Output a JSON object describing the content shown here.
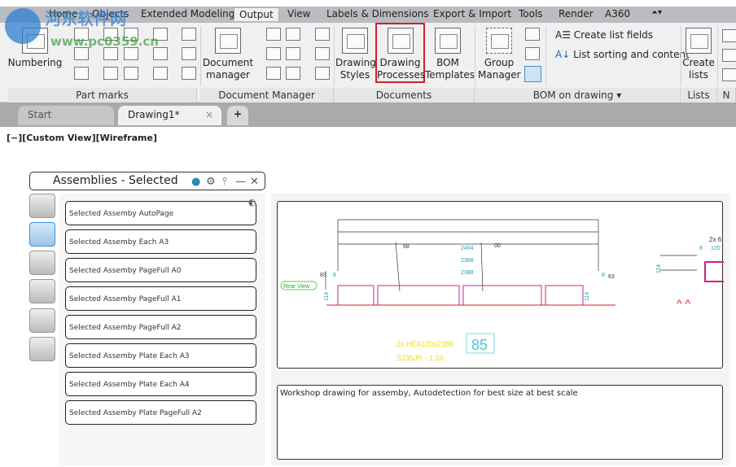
{
  "menu": {
    "tabs": [
      "Home",
      "Objects",
      "Extended Modeling",
      "Output",
      "View",
      "Labels & Dimensions",
      "Export & Import",
      "Tools",
      "Render",
      "A360"
    ],
    "active": "Output"
  },
  "ribbon": {
    "numbering": "Numbering",
    "document_manager": [
      "Document",
      "manager"
    ],
    "drawing_styles": [
      "Drawing",
      "Styles"
    ],
    "drawing_processes": [
      "Drawing",
      "Processes"
    ],
    "bom_templates": [
      "BOM",
      "Templates"
    ],
    "group_manager": [
      "Group",
      "Manager"
    ],
    "create_list_fields": "Create list fields",
    "list_sorting": "List sorting and content",
    "create_lists": [
      "Create",
      "lists"
    ],
    "panels": [
      "Part marks",
      "Document Manager",
      "Documents",
      "BOM on drawing",
      "Lists",
      "N"
    ],
    "highlight_color": "#d0202a"
  },
  "doctabs": {
    "start": "Start",
    "drawing": "Drawing1*",
    "close": "×",
    "add": "+"
  },
  "viewport_label": "[−][Custom View][Wireframe]",
  "palette": {
    "title": "Assemblies - Selected",
    "items": [
      "Selected Assemby   AutoPage",
      "Selected Assemby Each A3",
      "Selected Assemby PageFull A0",
      "Selected Assemby PageFull A1",
      "Selected Assemby PageFull A2",
      "Selected Assemby Plate Each A3",
      "Selected Assemby Plate Each A4",
      "Selected Assemby Plate PageFull A2"
    ],
    "description": "Workshop drawing for assemby, Autodetection for best size at best scale"
  },
  "drawing": {
    "dims": [
      "2404",
      "2388",
      "2388"
    ],
    "marks": [
      "68",
      "00",
      "83",
      "63",
      "8",
      "8",
      "114",
      "114",
      "2x 6",
      "120",
      "8",
      "114"
    ],
    "view_label": "Rear View",
    "title_line1": "2x HEA120x2388",
    "title_line2": "S235JR - 1:10",
    "part_number": "85"
  },
  "watermark": {
    "text": "河东软件网",
    "url": "www.pc0359.cn"
  }
}
